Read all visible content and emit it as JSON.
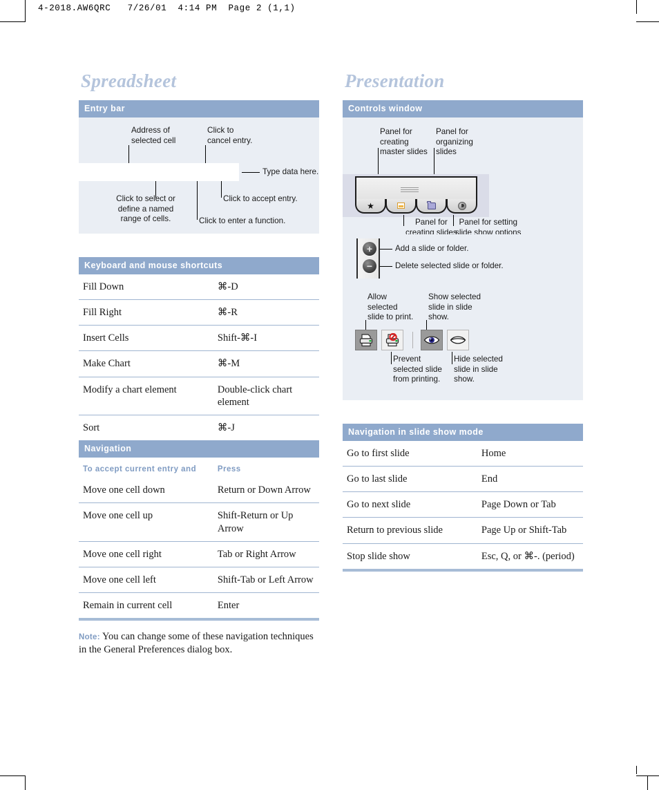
{
  "page": {
    "slug": "4-2018.AW6QRC   7/26/01  4:14 PM  Page 2 (1,1)"
  },
  "colors": {
    "header_bar": "#8fa9cc",
    "panel_bg": "#eaeef4",
    "title": "#b4c4dc",
    "rule": "#9fb4d0",
    "accent_text": "#7f9bc2"
  },
  "left_column": {
    "title": "Spreadsheet",
    "entry_bar": {
      "bar_label": "Entry bar",
      "callouts": {
        "address": "Address of\nselected cell",
        "cancel": "Click to\ncancel entry.",
        "type_data": "Type data here.",
        "named_range": "Click to select or\ndefine a named\nrange of cells.",
        "accept": "Click to accept entry.",
        "function": "Click to enter a function."
      }
    },
    "shortcuts": {
      "bar_label": "Keyboard and mouse shortcuts",
      "rows": [
        {
          "action": "Fill Down",
          "keys": "⌘-D"
        },
        {
          "action": "Fill Right",
          "keys": "⌘-R"
        },
        {
          "action": "Insert Cells",
          "keys": "Shift-⌘-I"
        },
        {
          "action": "Make Chart",
          "keys": "⌘-M"
        },
        {
          "action": "Modify a chart element",
          "keys": "Double-click chart element"
        },
        {
          "action": "Sort",
          "keys": "⌘-J"
        }
      ]
    },
    "navigation": {
      "bar_label": "Navigation",
      "header": {
        "action": "To accept current entry and",
        "keys": "Press"
      },
      "rows": [
        {
          "action": "Move one cell down",
          "keys": "Return or Down Arrow"
        },
        {
          "action": "Move one cell up",
          "keys": "Shift-Return or Up Arrow"
        },
        {
          "action": "Move one cell right",
          "keys": "Tab or Right Arrow"
        },
        {
          "action": "Move one cell left",
          "keys": "Shift-Tab or Left Arrow"
        },
        {
          "action": "Remain in current cell",
          "keys": "Enter"
        }
      ]
    },
    "note": {
      "lead": "Note:",
      "text": "You can change some of these navigation techniques in the General Preferences dialog box."
    }
  },
  "right_column": {
    "title": "Presentation",
    "controls_window": {
      "bar_label": "Controls window",
      "callouts": {
        "master_slides": "Panel for\ncreating\nmaster slides",
        "organizing": "Panel for\norganizing\nslides",
        "creating_slides": "Panel for\ncreating slides",
        "slide_show_options": "Panel for setting\nslide show options",
        "add": "Add a slide or folder.",
        "delete": "Delete selected slide or folder.",
        "allow_print": "Allow\nselected\nslide to print.",
        "show_in_show": "Show selected\nslide in slide\nshow.",
        "prevent_print": "Prevent\nselected slide\nfrom printing.",
        "hide_in_show": "Hide selected\nslide in slide\nshow."
      },
      "tabs": [
        {
          "name": "master-slides-tab",
          "icon": "star-icon"
        },
        {
          "name": "create-slides-tab",
          "icon": "slide-icon"
        },
        {
          "name": "organize-slides-tab",
          "icon": "folder-icon"
        },
        {
          "name": "slide-show-options-tab",
          "icon": "clock-icon"
        }
      ],
      "round_buttons": [
        {
          "name": "add-button",
          "glyph": "+"
        },
        {
          "name": "delete-button",
          "glyph": "−"
        }
      ],
      "toolbar": [
        {
          "name": "allow-print-button",
          "icon": "printer-icon",
          "state": "selected"
        },
        {
          "name": "prevent-print-button",
          "icon": "printer-blocked-icon",
          "state": "normal"
        },
        {
          "name": "show-slide-button",
          "icon": "eye-open-icon",
          "state": "selected"
        },
        {
          "name": "hide-slide-button",
          "icon": "eye-closed-icon",
          "state": "normal"
        }
      ]
    },
    "slideshow_nav": {
      "bar_label": "Navigation in slide show mode",
      "rows": [
        {
          "action": "Go to first slide",
          "keys": "Home"
        },
        {
          "action": "Go to last slide",
          "keys": "End"
        },
        {
          "action": "Go to next slide",
          "keys": "Page Down or Tab"
        },
        {
          "action": "Return to previous slide",
          "keys": "Page Up or Shift-Tab"
        },
        {
          "action": "Stop slide show",
          "keys": "Esc, Q, or ⌘-. (period)"
        }
      ]
    }
  }
}
